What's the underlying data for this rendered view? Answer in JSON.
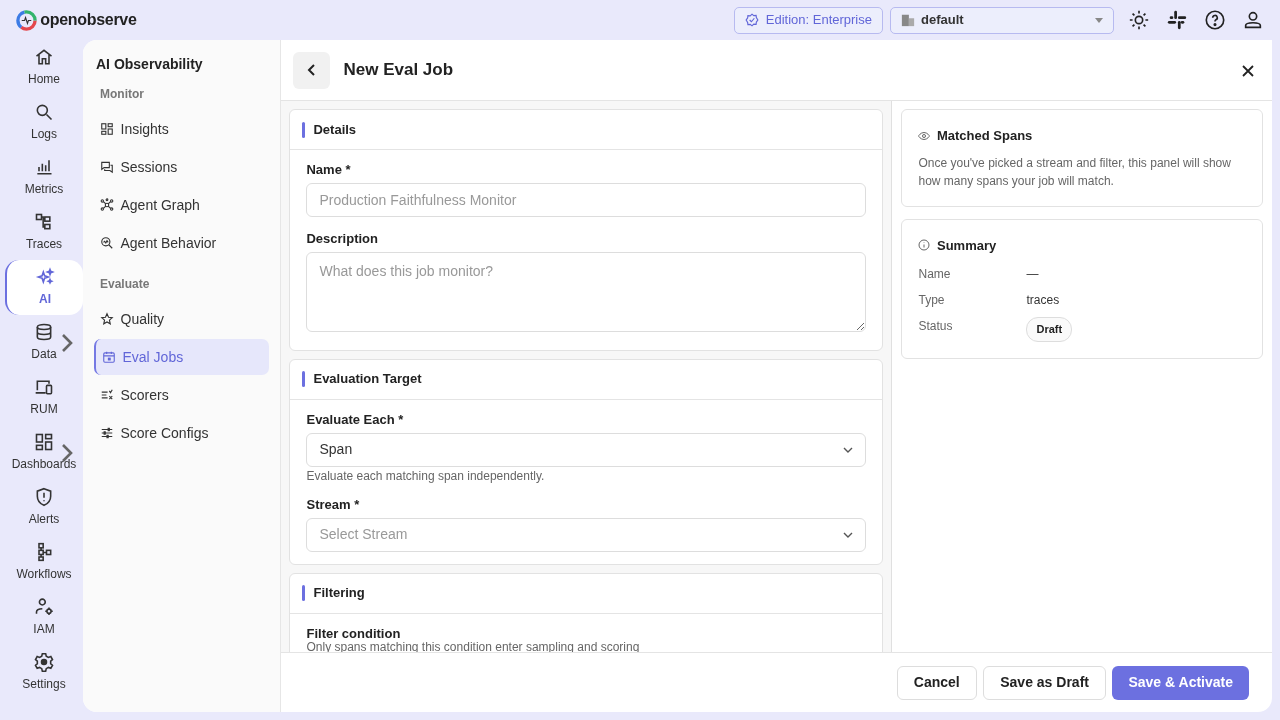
{
  "topbar": {
    "logo": "openobserve",
    "edition": "Edition: Enterprise",
    "org": "default"
  },
  "rail": [
    {
      "label": "Home",
      "selected": false,
      "submenu": false
    },
    {
      "label": "Logs",
      "selected": false,
      "submenu": false
    },
    {
      "label": "Metrics",
      "selected": false,
      "submenu": false
    },
    {
      "label": "Traces",
      "selected": false,
      "submenu": false
    },
    {
      "label": "AI",
      "selected": true,
      "submenu": false
    },
    {
      "label": "Data",
      "selected": false,
      "submenu": true
    },
    {
      "label": "RUM",
      "selected": false,
      "submenu": false
    },
    {
      "label": "Dashboards",
      "selected": false,
      "submenu": true
    },
    {
      "label": "Alerts",
      "selected": false,
      "submenu": false
    },
    {
      "label": "Workflows",
      "selected": false,
      "submenu": false
    },
    {
      "label": "IAM",
      "selected": false,
      "submenu": false
    },
    {
      "label": "Settings",
      "selected": false,
      "submenu": false
    }
  ],
  "subnav": {
    "title": "AI Observability",
    "sections": [
      {
        "heading": "Monitor",
        "items": [
          {
            "label": "Insights",
            "selected": false
          },
          {
            "label": "Sessions",
            "selected": false
          },
          {
            "label": "Agent Graph",
            "selected": false
          },
          {
            "label": "Agent Behavior",
            "selected": false
          }
        ]
      },
      {
        "heading": "Evaluate",
        "items": [
          {
            "label": "Quality",
            "selected": false
          },
          {
            "label": "Eval Jobs",
            "selected": true
          },
          {
            "label": "Scorers",
            "selected": false
          },
          {
            "label": "Score Configs",
            "selected": false
          }
        ]
      }
    ]
  },
  "page": {
    "title": "New Eval Job"
  },
  "sections": [
    {
      "title": "Details",
      "fields": [
        {
          "kind": "input",
          "label": "Name *",
          "placeholder": "Production Faithfulness Monitor"
        },
        {
          "kind": "textarea",
          "label": "Description",
          "placeholder": "What does this job monitor?"
        }
      ]
    },
    {
      "title": "Evaluation Target",
      "fields": [
        {
          "kind": "select",
          "label": "Evaluate Each *",
          "value": "Span",
          "hint": "Evaluate each matching span independently."
        },
        {
          "kind": "select",
          "label": "Stream *",
          "placeholder": "Select Stream"
        }
      ]
    },
    {
      "title": "Filtering",
      "fields": [
        {
          "kind": "heading",
          "label": "Filter condition",
          "hint": "Only spans matching this condition enter sampling and scoring"
        }
      ]
    }
  ],
  "matched": {
    "title": "Matched Spans",
    "text": "Once you've picked a stream and filter, this panel will show how many spans your job will match."
  },
  "summary": {
    "title": "Summary",
    "rows": [
      {
        "label": "Name",
        "value": "—",
        "kind": "text"
      },
      {
        "label": "Type",
        "value": "traces",
        "kind": "text"
      },
      {
        "label": "Status",
        "value": "Draft",
        "kind": "badge"
      }
    ]
  },
  "buttons": [
    {
      "label": "Cancel",
      "kind": "outline"
    },
    {
      "label": "Save as Draft",
      "kind": "outline"
    },
    {
      "label": "Save & Activate",
      "kind": "primary"
    }
  ]
}
